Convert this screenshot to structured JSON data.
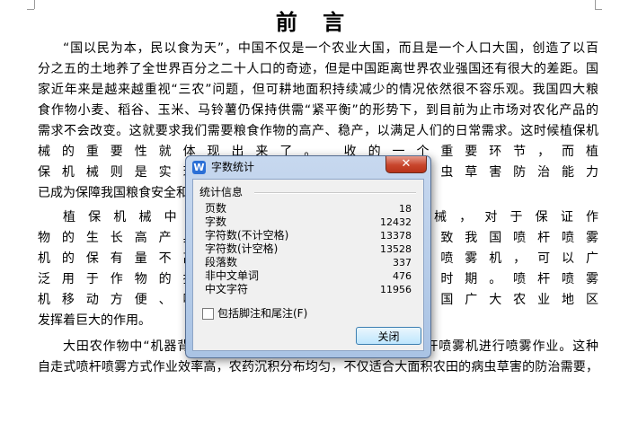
{
  "document": {
    "title": "前 言",
    "lines": [
      "“国以民为本，民以食为天”，中国不仅是一个农业大国，而且是一个人口大国，创造了以百",
      "分之五的土地养了全世界百分之二十人口的奇迹，但是中国距离世界农业强国还有很大的差距。国",
      "家近年来是越来越重视“三农”问题，但可耕地面积持续减少的情况依然很不容乐观。我国四大粮",
      "食作物小麦、稻谷、玉米、马铃薯仍保持供需“紧平衡”的形势下，到目前为止市场对农化产品的",
      "需求不会改变。这就要求我们需要粮食作物的高产、稳产，以满足人们的日常需求。这时候植保机",
      "械的重要性就体现出来了。                                    收的一个重要环节，而植",
      "保机械则是实现这一目的必                                      高植物病虫草害防治能力",
      "已成为保障我国粮食安全和",
      "植保机械中使用频率最                                          性喷雾机械，对于保证作",
      "物的生长高产具有重要作用                                      原因，导致我国喷杆喷雾",
      "机的保有量不高。喷杆喷雾                                      喷杆）的喷雾机，可以广",
      "泛用于作物的播前、苗前土                                      长的各个时期。喷杆喷雾",
      "机移动方便、喷幅宽、喷洒                                      械，在我国广大农业地区",
      "发挥着巨大的作用。",
      "大田农作物中“机器背着人”喷雾作业最常见的就是采用大田喷杆喷雾机进行喷雾作业。这种",
      "自走式喷杆喷雾方式作业效率高，农药沉积分布均匀，不仅适合大面积农田的病虫草害的防治需要，"
    ]
  },
  "dialog": {
    "title": "字数统计",
    "app_icon": "W",
    "close_icon": "✕",
    "group_label": "统计信息",
    "stats": [
      {
        "label": "页数",
        "value": "18"
      },
      {
        "label": "字数",
        "value": "12432"
      },
      {
        "label": "字符数(不计空格)",
        "value": "13378"
      },
      {
        "label": "字符数(计空格)",
        "value": "13528"
      },
      {
        "label": "段落数",
        "value": "337"
      },
      {
        "label": "非中文单词",
        "value": "476"
      },
      {
        "label": "中文字符",
        "value": "11956"
      }
    ],
    "checkbox_label": "包括脚注和尾注(F)",
    "checkbox_checked": false,
    "close_button_label": "关闭"
  }
}
